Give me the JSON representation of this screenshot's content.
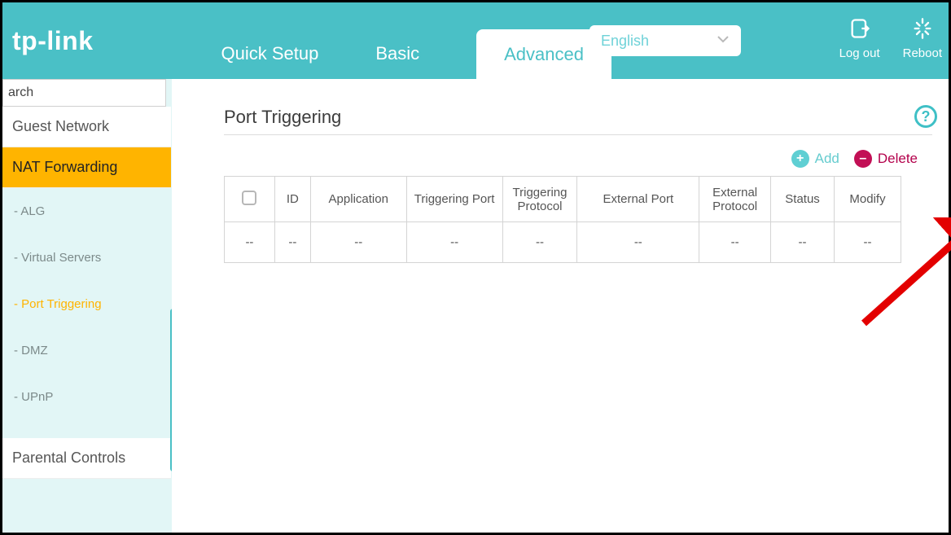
{
  "brand": "tp-link",
  "nav": {
    "quick": "Quick Setup",
    "basic": "Basic",
    "advanced": "Advanced"
  },
  "language": {
    "selected": "English"
  },
  "top_actions": {
    "logout": "Log out",
    "reboot": "Reboot"
  },
  "search": {
    "placeholder": "arch"
  },
  "sidebar": {
    "items": [
      {
        "label": "Guest Network"
      },
      {
        "label": "NAT Forwarding"
      },
      {
        "label": "Parental Controls"
      }
    ],
    "subitems": [
      {
        "label": "- ALG"
      },
      {
        "label": "- Virtual Servers"
      },
      {
        "label": "- Port Triggering"
      },
      {
        "label": "- DMZ"
      },
      {
        "label": "- UPnP"
      }
    ]
  },
  "page": {
    "title": "Port Triggering"
  },
  "actions": {
    "add": "Add",
    "delete": "Delete"
  },
  "table": {
    "headers": {
      "id": "ID",
      "application": "Application",
      "trig_port": "Triggering Port",
      "trig_proto": "Triggering Protocol",
      "ext_port": "External Port",
      "ext_proto": "External Protocol",
      "status": "Status",
      "modify": "Modify"
    },
    "row": {
      "id": "--",
      "application": "--",
      "trig_port": "--",
      "trig_proto": "--",
      "ext_port": "--",
      "ext_proto": "--",
      "status": "--",
      "modify": "--",
      "chk": "--"
    }
  }
}
